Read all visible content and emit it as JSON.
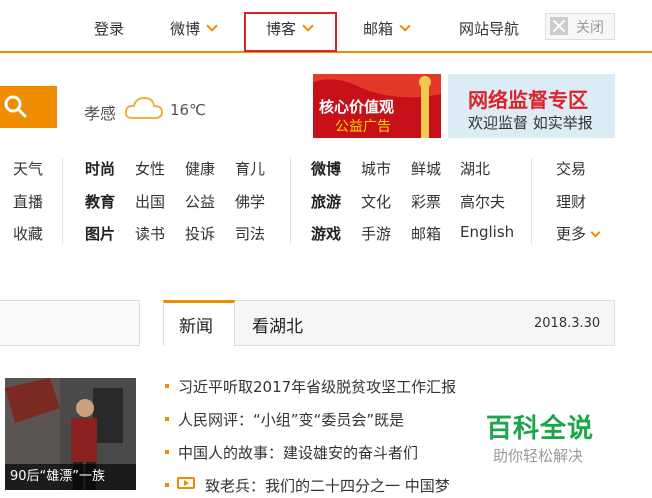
{
  "topnav": {
    "login": "登录",
    "weibo": "微博",
    "blog": "博客",
    "mail": "邮箱",
    "site_nav": "网站导航",
    "close": "关闭"
  },
  "weather": {
    "city": "孝感",
    "temp": "16℃"
  },
  "banners": {
    "banner1_line1": "核心价值观",
    "banner1_line2": "公益广告",
    "banner2_line1": "网络监督专区",
    "banner2_line2": "欢迎监督 如实举报"
  },
  "channels": {
    "col0": [
      "天气",
      "直播",
      "收藏"
    ],
    "col1": [
      "时尚",
      "教育",
      "图片"
    ],
    "col2": [
      "女性",
      "出国",
      "读书"
    ],
    "col3": [
      "健康",
      "公益",
      "投诉"
    ],
    "col4": [
      "育儿",
      "佛学",
      "司法"
    ],
    "col5": [
      "微博",
      "旅游",
      "游戏"
    ],
    "col6": [
      "城市",
      "文化",
      "手游"
    ],
    "col7": [
      "鲜城",
      "彩票",
      "邮箱"
    ],
    "col8": [
      "湖北",
      "高尔夫",
      "English"
    ],
    "col9": [
      "交易",
      "理财",
      "更多"
    ]
  },
  "tabs": {
    "news": "新闻",
    "hubei": "看湖北",
    "date": "2018.3.30"
  },
  "photo_caption": "90后“雄漂”一族",
  "news": [
    "习近平听取2017年省级脱贫攻坚工作汇报",
    "人民网评：“小组”变“委员会”既是",
    "中国人的故事：建设雄安的奋斗者们",
    "致老兵：我们的二十四分之一 中国梦"
  ],
  "watermark": {
    "title": "百科全说",
    "subtitle": "助你轻松解决"
  },
  "colors": {
    "accent": "#f08c00",
    "highlight": "#d9242b",
    "watermark": "#1aa64a"
  }
}
